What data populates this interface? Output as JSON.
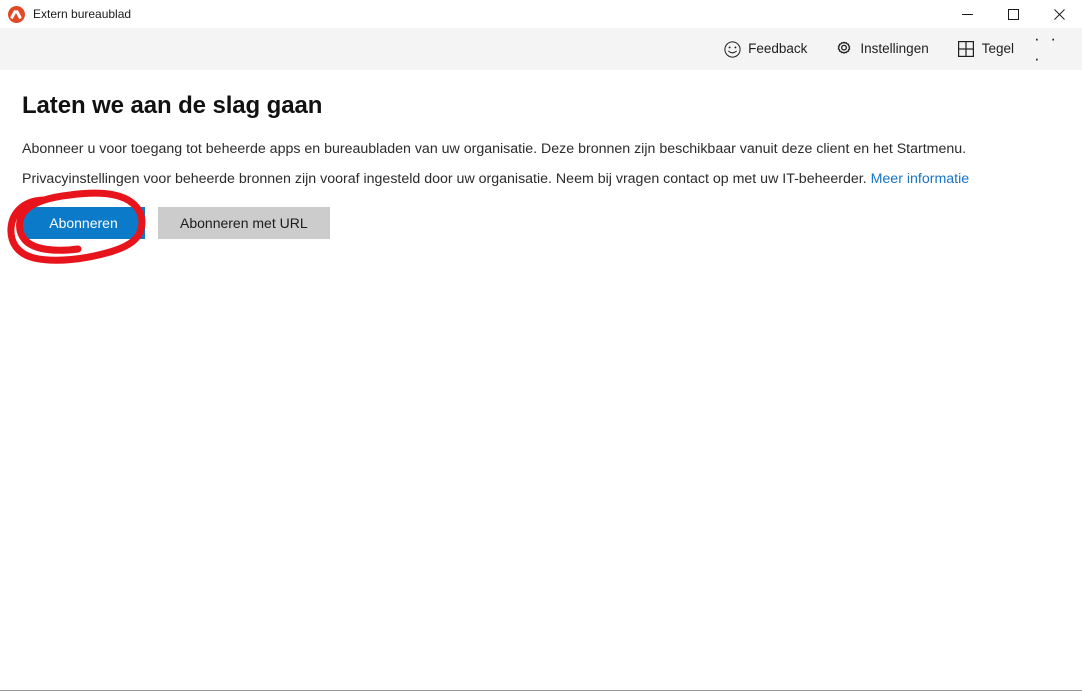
{
  "window": {
    "title": "Extern bureaublad",
    "app_icon": "remote-desktop-icon",
    "controls": {
      "minimize": "minimize-icon",
      "maximize": "maximize-icon",
      "close": "close-icon"
    }
  },
  "toolbar": {
    "items": [
      {
        "label": "Feedback",
        "icon": "smiley-face-icon"
      },
      {
        "label": "Instellingen",
        "icon": "gear-icon"
      },
      {
        "label": "Tegel",
        "icon": "grid-tile-icon"
      }
    ],
    "overflow_label": "· · ·",
    "overflow_icon": "ellipsis-icon"
  },
  "main": {
    "heading": "Laten we aan de slag gaan",
    "paragraph_1": "Abonneer u voor toegang tot beheerde apps en bureaubladen van uw organisatie. Deze bronnen zijn beschikbaar vanuit deze client en het Startmenu.",
    "paragraph_2_text": "Privacyinstellingen voor beheerde bronnen zijn vooraf ingesteld door uw organisatie. Neem bij vragen contact op met uw IT-beheerder.",
    "paragraph_2_link": "Meer informatie",
    "buttons": {
      "primary": "Abonneren",
      "secondary": "Abonneren met URL"
    }
  },
  "annotation": {
    "shape": "hand-drawn-red-circle",
    "color": "#e8141b",
    "target": "Abonneren"
  },
  "colors": {
    "accent_blue": "#0a7ac9",
    "link_blue": "#1675c4",
    "secondary_button": "#cccccc",
    "toolbar_bg": "#f4f4f4",
    "app_icon": "#e04a26",
    "annotation_red": "#e8141b"
  }
}
